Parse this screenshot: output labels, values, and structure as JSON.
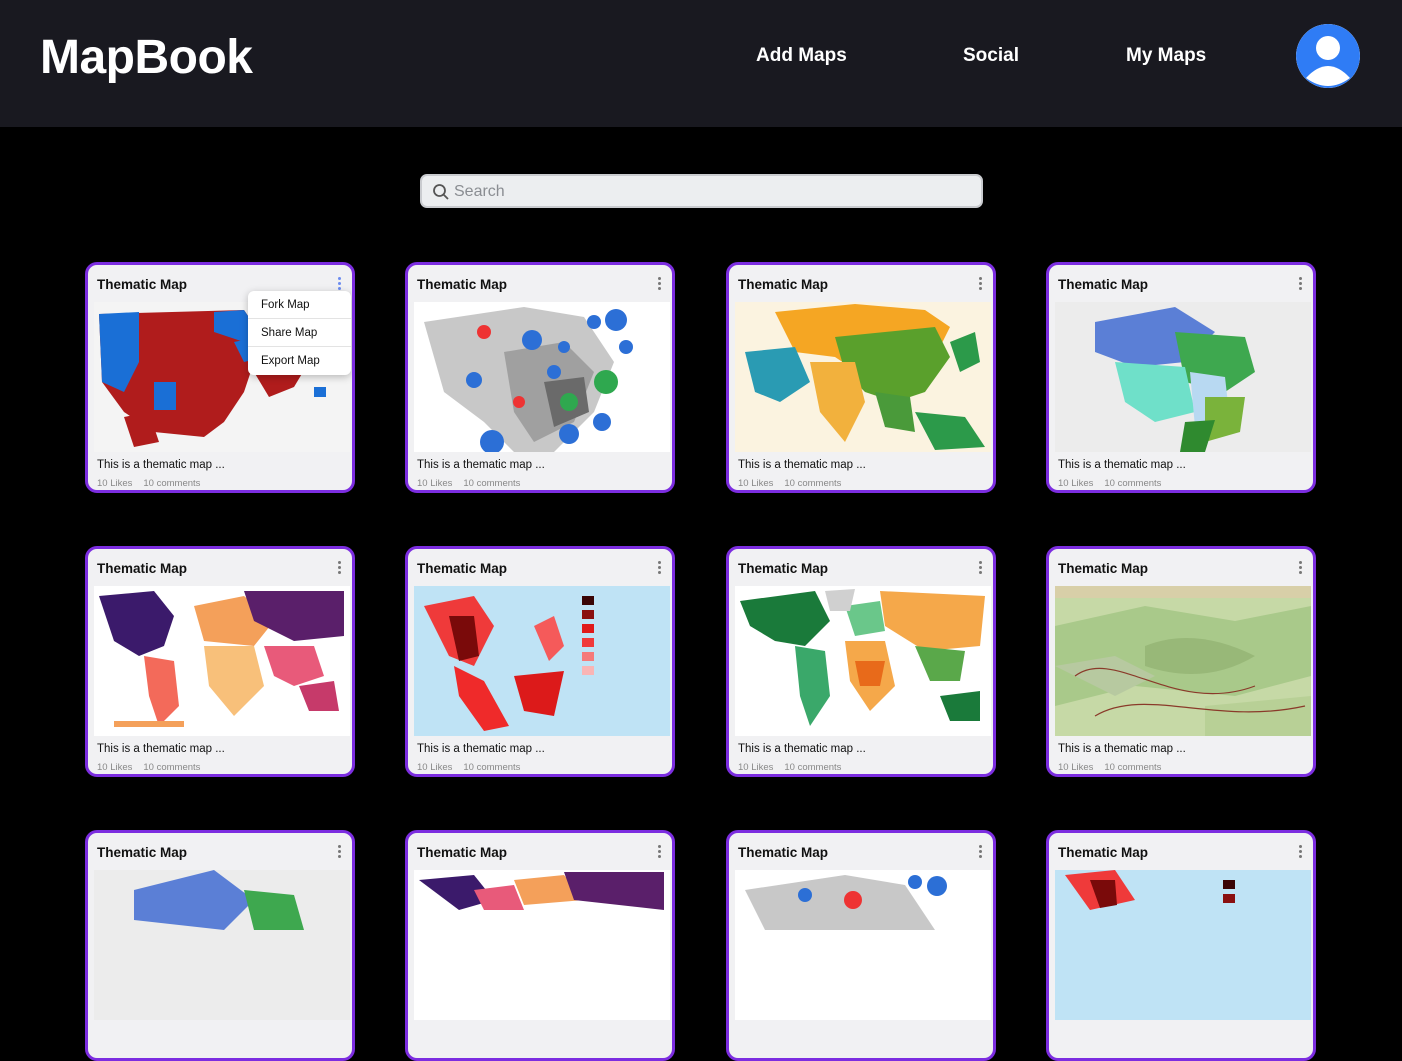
{
  "header": {
    "logo": "MapBook",
    "nav": [
      "Add Maps",
      "Social",
      "My Maps"
    ]
  },
  "search": {
    "placeholder": "Search"
  },
  "colors": {
    "accent": "#7c2de0",
    "header_bg": "#191920",
    "avatar": "#2f7cf5"
  },
  "dropdown": {
    "items": [
      "Fork Map",
      "Share Map",
      "Export Map"
    ]
  },
  "cards": [
    {
      "title": "Thematic Map",
      "desc": "This is a thematic map ...",
      "likes": "10 Likes",
      "comments": "10 comments"
    },
    {
      "title": "Thematic Map",
      "desc": "This is a thematic map ...",
      "likes": "10 Likes",
      "comments": "10 comments"
    },
    {
      "title": "Thematic Map",
      "desc": "This is a thematic map ...",
      "likes": "10 Likes",
      "comments": "10 comments"
    },
    {
      "title": "Thematic Map",
      "desc": "This is a thematic map ...",
      "likes": "10 Likes",
      "comments": "10 comments"
    },
    {
      "title": "Thematic Map",
      "desc": "This is a thematic map ...",
      "likes": "10 Likes",
      "comments": "10 comments"
    },
    {
      "title": "Thematic Map",
      "desc": "This is a thematic map ...",
      "likes": "10 Likes",
      "comments": "10 comments"
    },
    {
      "title": "Thematic Map",
      "desc": "This is a thematic map ...",
      "likes": "10 Likes",
      "comments": "10 comments"
    },
    {
      "title": "Thematic Map",
      "desc": "This is a thematic map ...",
      "likes": "10 Likes",
      "comments": "10 comments"
    },
    {
      "title": "Thematic Map"
    },
    {
      "title": "Thematic Map"
    },
    {
      "title": "Thematic Map"
    },
    {
      "title": "Thematic Map"
    }
  ]
}
